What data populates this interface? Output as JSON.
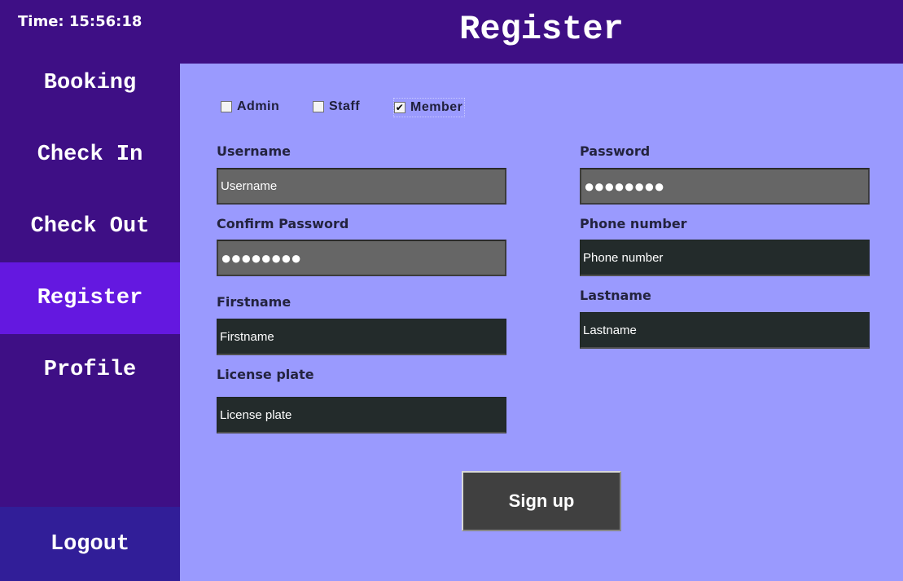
{
  "header": {
    "clock": "Time: 15:56:18",
    "title": "Register"
  },
  "sidebar": {
    "items": [
      {
        "label": "Booking"
      },
      {
        "label": "Check In"
      },
      {
        "label": "Check Out"
      },
      {
        "label": "Register",
        "active": true
      },
      {
        "label": "Profile"
      }
    ],
    "logout": "Logout"
  },
  "roles": [
    {
      "label": "Admin",
      "checked": false
    },
    {
      "label": "Staff",
      "checked": false
    },
    {
      "label": "Member",
      "checked": true
    }
  ],
  "form": {
    "username": {
      "label": "Username",
      "value": "Username"
    },
    "password": {
      "label": "Password",
      "value": "●●●●●●●●"
    },
    "confirm_password": {
      "label": "Confirm Password",
      "value": "●●●●●●●●"
    },
    "phone": {
      "label": "Phone number",
      "value": "Phone number"
    },
    "firstname": {
      "label": "Firstname",
      "value": "Firstname"
    },
    "lastname": {
      "label": "Lastname",
      "value": "Lastname"
    },
    "license_plate": {
      "label": "License plate",
      "value": "License plate"
    }
  },
  "signup_label": "Sign up",
  "check_mark": "✔",
  "colors": {
    "sidebar_bg": "#3e0f85",
    "active_nav": "#6418e0",
    "logout_bg": "#311e98",
    "content_bg": "#9a9afe",
    "field_gray": "#666666",
    "field_dark": "#232b2b",
    "button_bg": "#404040"
  }
}
